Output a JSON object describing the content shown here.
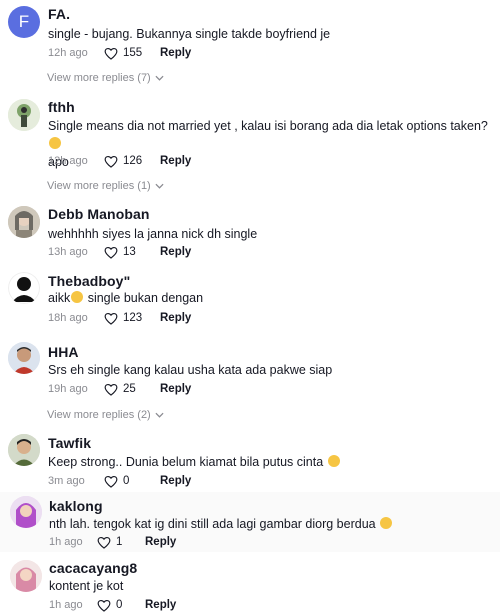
{
  "comments": [
    {
      "name": "FA.",
      "avatar_letter": "F",
      "text": "single - bujang. Bukannya single takde boyfriend je",
      "ago": "12h ago",
      "likes": "155",
      "reply": "Reply",
      "view_more": "View more replies (7)"
    },
    {
      "name": "fthh",
      "text": "Single means dia not married yet , kalau isi borang ada dia letak options taken?",
      "text2": "apo",
      "ago": "12h ago",
      "likes": "126",
      "reply": "Reply",
      "view_more": "View more replies (1)"
    },
    {
      "name": "Debb Manoban",
      "text": "wehhhhh siyes la janna nick dh single",
      "ago": "13h ago",
      "likes": "13",
      "reply": "Reply"
    },
    {
      "name": "Thebadboy\"",
      "text_a": "aikk",
      "text_b": " single bukan dengan",
      "ago": "18h ago",
      "likes": "123",
      "reply": "Reply"
    },
    {
      "name": "HHA",
      "text": "Srs eh single kang kalau usha kata ada pakwe siap",
      "ago": "19h ago",
      "likes": "25",
      "reply": "Reply",
      "view_more": "View more replies (2)"
    },
    {
      "name": "Tawfik",
      "text": "Keep strong.. Dunia belum kiamat bila putus cinta",
      "ago": "3m ago",
      "likes": "0",
      "reply": "Reply"
    },
    {
      "name": "kaklong",
      "text": "nth lah. tengok kat ig dini still ada lagi gambar diorg berdua",
      "ago": "1h ago",
      "likes": "1",
      "reply": "Reply"
    },
    {
      "name": "cacacayang8",
      "text": "kontent je kot",
      "ago": "1h ago",
      "likes": "0",
      "reply": "Reply"
    }
  ],
  "colors": {
    "avatar_fa": "#5a6ee0",
    "muted": "#8a8b91",
    "text": "#161823"
  }
}
